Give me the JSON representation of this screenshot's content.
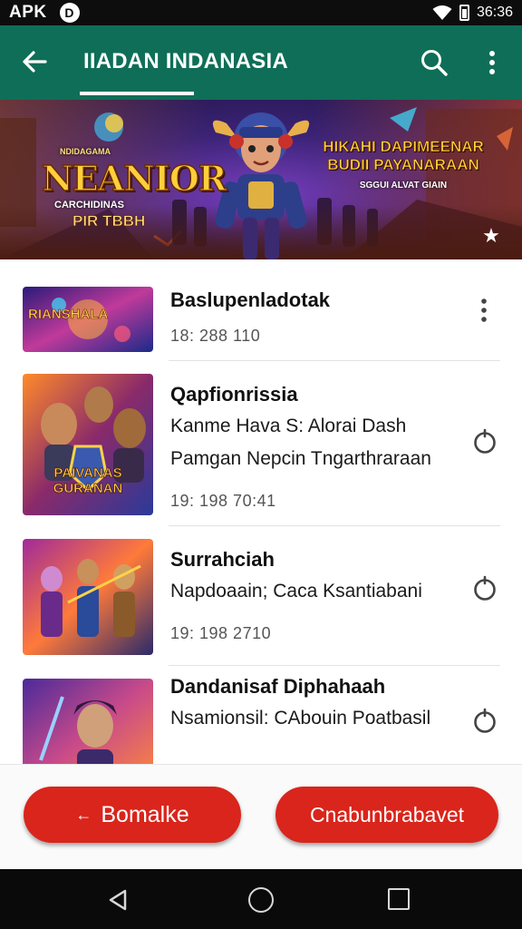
{
  "status_bar": {
    "left_label": "APK",
    "logo_glyph": "D",
    "time": "36:36"
  },
  "app_bar": {
    "title": "IIADAN INDANASIA",
    "back_icon": "arrow-left-icon",
    "search_icon": "search-icon",
    "more_icon": "more-vert-icon"
  },
  "banner": {
    "logo_top": "NDIDAGAMA",
    "logo_main": "NEANIOR",
    "logo_sub": "CARCHIDINAS",
    "logo_sub2": "PIR TBBH",
    "right_title_line1": "HIKAHI DAPIMEENAR",
    "right_title_line2": "BUDII PAYANARAAN",
    "right_subtitle": "SGGUI ALVAT GIAIN",
    "star_icon": "star-icon"
  },
  "list": {
    "items": [
      {
        "title": "Baslupenladotak",
        "desc1": "",
        "desc2": "",
        "meta": "18: 288  110",
        "thumb_text": "RIANSHALA",
        "action_icon": "more-vert-icon"
      },
      {
        "title": "Qapfionrissia",
        "desc1": "Kanme Hava S: Alorai Dash",
        "desc2": "Pamgan Nepcin Tngarthraraan",
        "meta": "19: 198  70:41",
        "thumb_text": "PAIVANAS GURANAN",
        "action_icon": "download-icon"
      },
      {
        "title": "Surrahciah",
        "desc1": "Napdoaain; Caca Ksantiabani",
        "desc2": "",
        "meta": "19: 198  2710",
        "thumb_text": "",
        "action_icon": "download-icon"
      },
      {
        "title": "Dandanisaf Diphahaah",
        "desc1": "Nsamionsil: CAbouin Poatbasil",
        "desc2": "",
        "meta": "",
        "thumb_text": "",
        "action_icon": "download-icon"
      }
    ]
  },
  "buttons": {
    "left_label": "Bomalke",
    "left_arrow": "←",
    "right_label": "Cnabunbrabavet"
  },
  "nav_bar": {
    "back_icon": "nav-back-icon",
    "home_icon": "nav-home-icon",
    "recent_icon": "nav-recents-icon"
  }
}
